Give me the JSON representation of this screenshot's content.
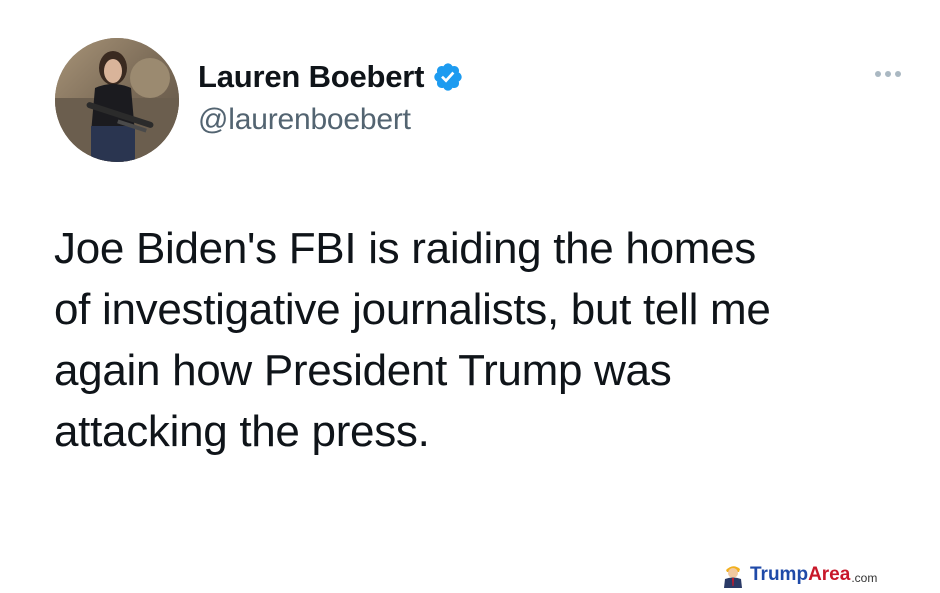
{
  "author": {
    "display_name": "Lauren Boebert",
    "handle": "@laurenboebert",
    "verified": true,
    "avatar_icon": "profile-photo"
  },
  "tweet": {
    "text": "Joe Biden's FBI is raiding the homes\nof investigative journalists, but tell me\nagain how President Trump was\nattacking the press."
  },
  "menu": {
    "icon": "more-options-icon"
  },
  "watermark": {
    "brand_part1": "Trump",
    "brand_part2": "Area",
    "brand_suffix": ".com"
  },
  "colors": {
    "verified_blue": "#1d9bf0",
    "text_primary": "#0f1419",
    "text_secondary": "#536471",
    "watermark_blue": "#1f4aa8",
    "watermark_red": "#c8182a"
  }
}
